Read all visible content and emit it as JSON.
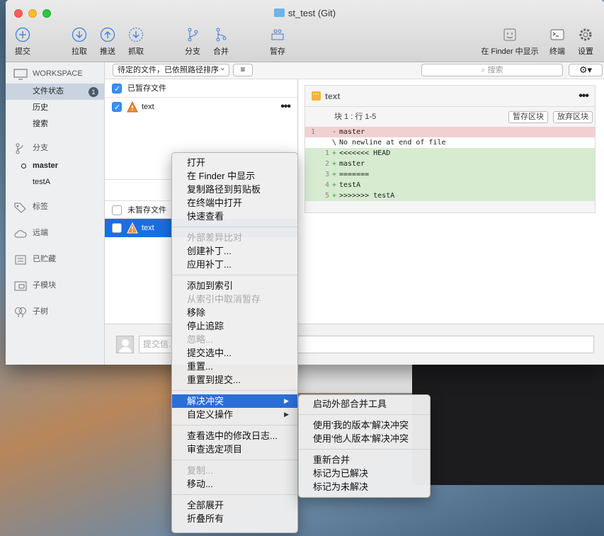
{
  "window": {
    "title": "st_test (Git)"
  },
  "toolbar": [
    {
      "label": "提交",
      "icon": "plus-circle-icon"
    },
    {
      "label": "拉取",
      "icon": "pull-arrow-icon"
    },
    {
      "label": "推送",
      "icon": "push-arrow-icon"
    },
    {
      "label": "抓取",
      "icon": "fetch-icon"
    },
    {
      "label": "分支",
      "icon": "branch-icon"
    },
    {
      "label": "合并",
      "icon": "merge-icon"
    },
    {
      "label": "暂存",
      "icon": "stash-icon"
    },
    {
      "label": "在 Finder 中显示",
      "icon": "finder-icon"
    },
    {
      "label": "终端",
      "icon": "terminal-icon"
    },
    {
      "label": "设置",
      "icon": "gear-icon"
    }
  ],
  "sidebar": {
    "workspace": "WORKSPACE",
    "file_status": "文件状态",
    "file_status_badge": "1",
    "history": "历史",
    "search": "搜索",
    "branches": "分支",
    "branch_master": "master",
    "branch_testA": "testA",
    "tags": "标签",
    "remotes": "远端",
    "stashes": "已贮藏",
    "submodules": "子模块",
    "subtrees": "子树"
  },
  "filterbar": {
    "sort_select": "待定的文件，已依照路径排序",
    "search_placeholder": "搜索",
    "list_icon": "≡",
    "gear": "⚙▾"
  },
  "files": {
    "staged_header": "已暂存文件",
    "staged_file": "text",
    "unstaged_header": "未暂存文件",
    "unstaged_file": "text",
    "more": "•••"
  },
  "diff": {
    "filename": "text",
    "more": "•••",
    "hunk_label": "块 1 :  行 1-5",
    "stage_hunk": "暂存区块",
    "discard_hunk": "放弃区块",
    "lines": [
      {
        "ln1": "1",
        "ln2": "",
        "sign": "-",
        "text": "master",
        "type": "del"
      },
      {
        "ln1": "",
        "ln2": "",
        "sign": "\\",
        "text": "No newline at end of file",
        "type": "note"
      },
      {
        "ln1": "",
        "ln2": "1",
        "sign": "+",
        "text": "<<<<<<< HEAD",
        "type": "add"
      },
      {
        "ln1": "",
        "ln2": "2",
        "sign": "+",
        "text": "master",
        "type": "add"
      },
      {
        "ln1": "",
        "ln2": "3",
        "sign": "+",
        "text": "=======",
        "type": "add"
      },
      {
        "ln1": "",
        "ln2": "4",
        "sign": "+",
        "text": "testA",
        "type": "add"
      },
      {
        "ln1": "",
        "ln2": "5",
        "sign": "+",
        "text": ">>>>>>> testA",
        "type": "add"
      }
    ]
  },
  "commit": {
    "placeholder": "提交信..."
  },
  "context_menu": {
    "open": "打开",
    "show_in_finder": "在 Finder 中显示",
    "copy_path": "复制路径到剪贴板",
    "open_in_terminal": "在终端中打开",
    "quick_look": "快速查看",
    "external_diff": "外部差异比对",
    "create_patch": "创建补丁...",
    "apply_patch": "应用补丁...",
    "add_to_index": "添加到索引",
    "unstage_from_index": "从索引中取消暂存",
    "remove": "移除",
    "stop_tracking": "停止追踪",
    "ignore": "忽略...",
    "commit_selected": "提交选中...",
    "reset": "重置...",
    "reset_to_commit": "重置到提交...",
    "resolve_conflicts": "解决冲突",
    "custom_actions": "自定义操作",
    "log_selected": "查看选中的修改日志...",
    "annotate_selected": "审查选定项目",
    "copy": "复制...",
    "move": "移动...",
    "expand_all": "全部展开",
    "collapse_all": "折叠所有",
    "arrow": "▶"
  },
  "submenu": {
    "launch_merge_tool": "启动外部合并工具",
    "resolve_mine": "使用'我的版本'解决冲突",
    "resolve_theirs": "使用'他人版本'解决冲突",
    "restart_merge": "重新合并",
    "mark_resolved": "标记为已解决",
    "mark_unresolved": "标记为未解决"
  }
}
